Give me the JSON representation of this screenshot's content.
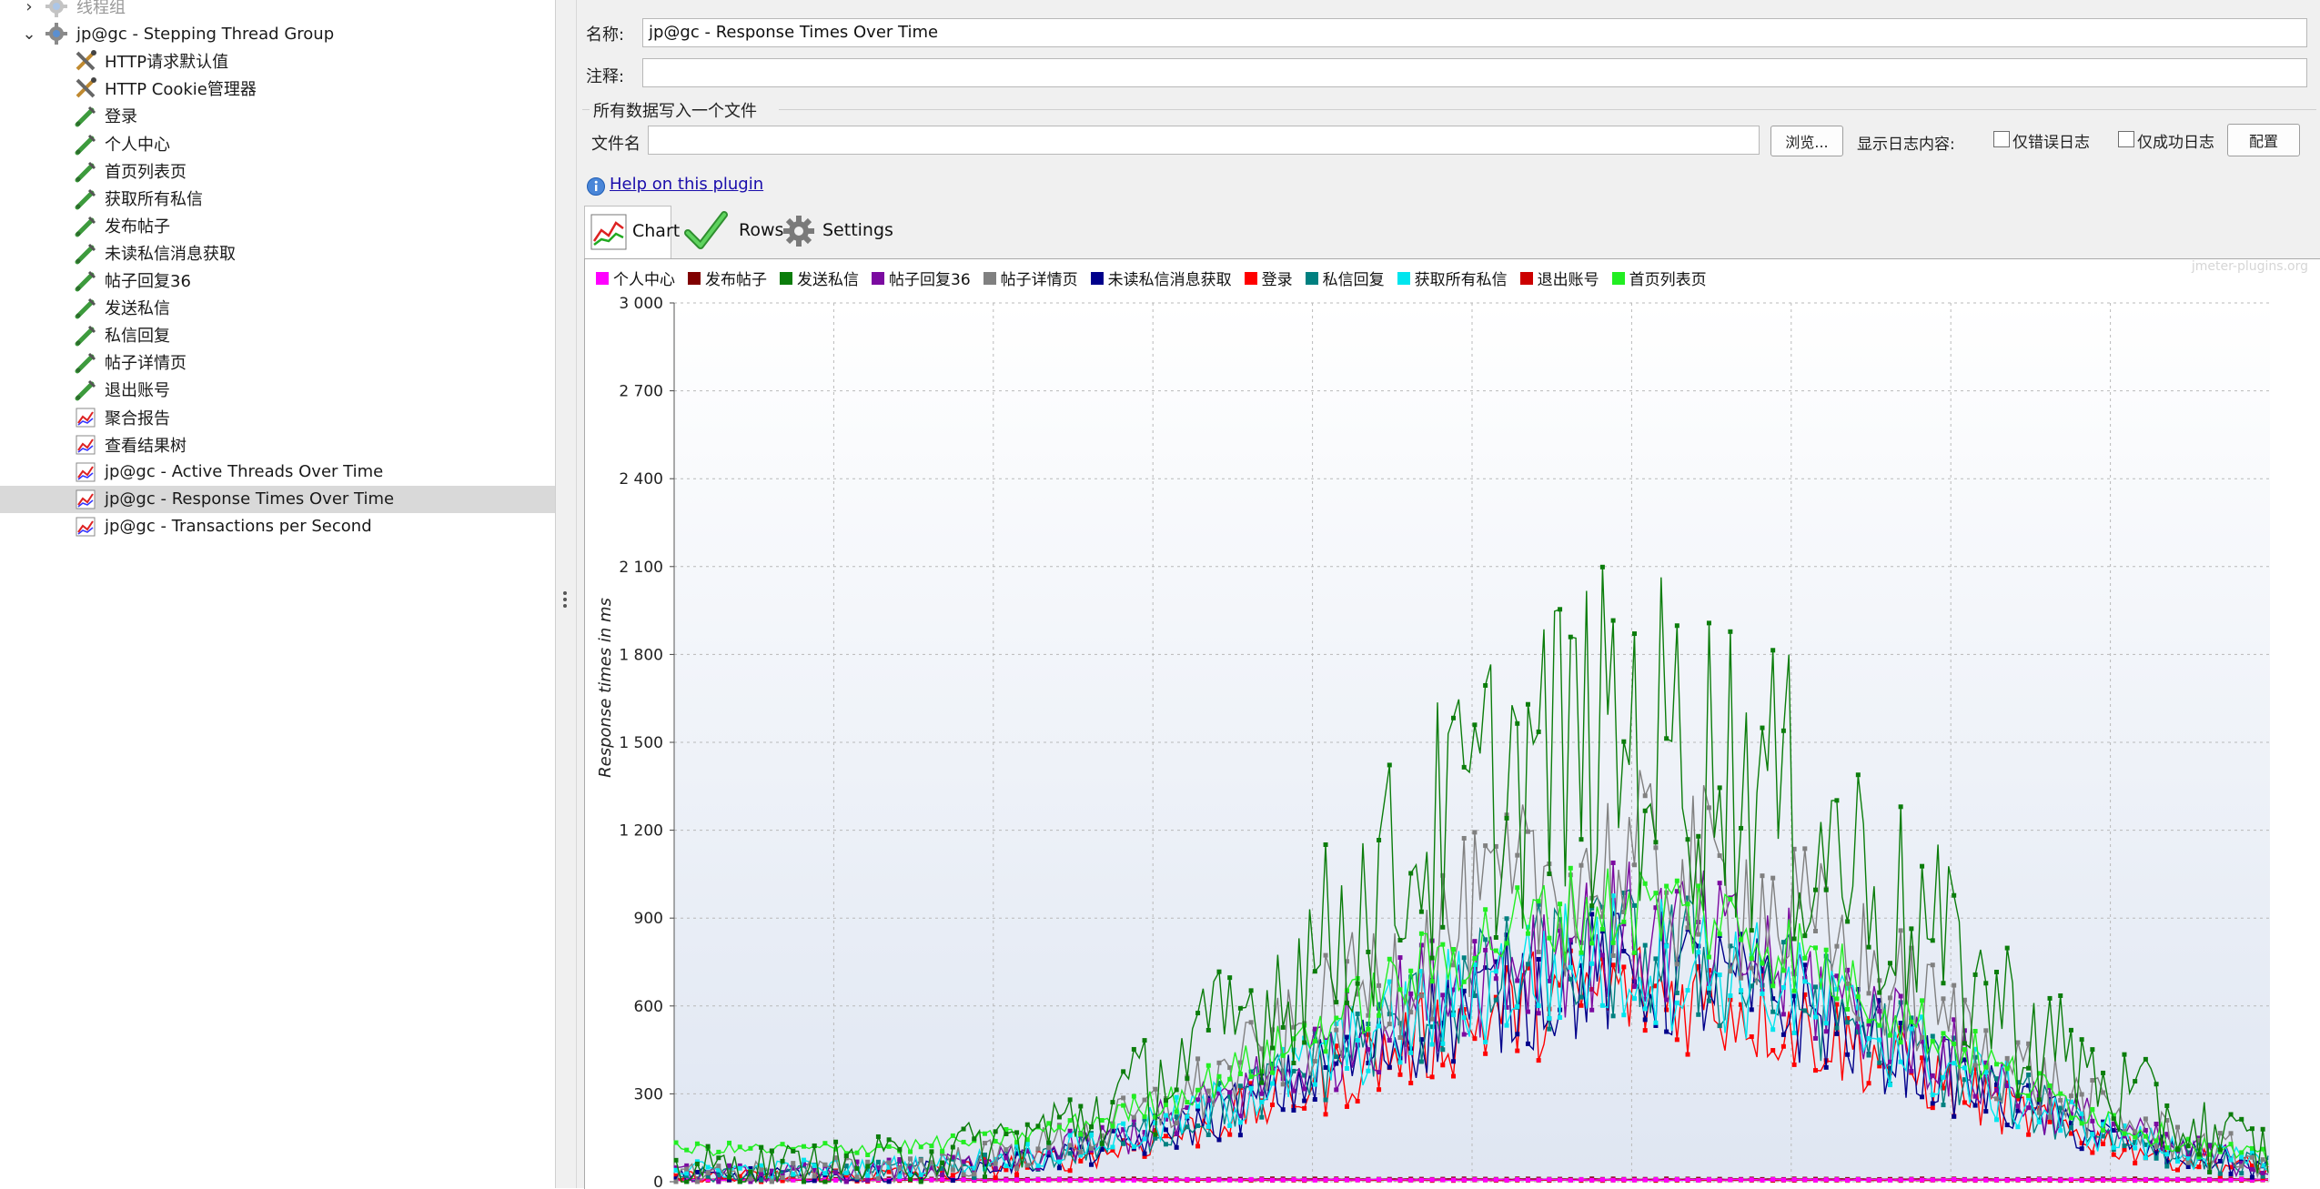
{
  "tree": {
    "items": [
      {
        "label": "线程组",
        "icon": "gear-icon",
        "indent": 0,
        "toggle": "›",
        "faded": true
      },
      {
        "label": "jp@gc - Stepping Thread Group",
        "icon": "gear-icon",
        "indent": 0,
        "toggle": "⌄",
        "faded": false
      },
      {
        "label": "HTTP请求默认值",
        "icon": "wrench-icon",
        "indent": 1
      },
      {
        "label": "HTTP Cookie管理器",
        "icon": "wrench-icon",
        "indent": 1
      },
      {
        "label": "登录",
        "icon": "sampler-icon",
        "indent": 1
      },
      {
        "label": "个人中心",
        "icon": "sampler-icon",
        "indent": 1
      },
      {
        "label": "首页列表页",
        "icon": "sampler-icon",
        "indent": 1
      },
      {
        "label": "获取所有私信",
        "icon": "sampler-icon",
        "indent": 1
      },
      {
        "label": "发布帖子",
        "icon": "sampler-icon",
        "indent": 1
      },
      {
        "label": "未读私信消息获取",
        "icon": "sampler-icon",
        "indent": 1
      },
      {
        "label": "帖子回复36",
        "icon": "sampler-icon",
        "indent": 1
      },
      {
        "label": "发送私信",
        "icon": "sampler-icon",
        "indent": 1
      },
      {
        "label": "私信回复",
        "icon": "sampler-icon",
        "indent": 1
      },
      {
        "label": "帖子详情页",
        "icon": "sampler-icon",
        "indent": 1
      },
      {
        "label": "退出账号",
        "icon": "sampler-icon",
        "indent": 1
      },
      {
        "label": "聚合报告",
        "icon": "listener-icon",
        "indent": 1
      },
      {
        "label": "查看结果树",
        "icon": "listener-icon",
        "indent": 1
      },
      {
        "label": "jp@gc - Active Threads Over Time",
        "icon": "listener-icon",
        "indent": 1
      },
      {
        "label": "jp@gc - Response Times Over Time",
        "icon": "listener-icon",
        "indent": 1,
        "selected": true
      },
      {
        "label": "jp@gc - Transactions per Second",
        "icon": "listener-icon",
        "indent": 1
      }
    ]
  },
  "form": {
    "name_label": "名称:",
    "name_value": "jp@gc - Response Times Over Time",
    "comment_label": "注释:",
    "comment_value": "",
    "file_group_title": "所有数据写入一个文件",
    "filename_label": "文件名",
    "filename_value": "",
    "browse_label": "浏览...",
    "log_display_label": "显示日志内容:",
    "errors_only_label": "仅错误日志",
    "success_only_label": "仅成功日志",
    "configure_label": "配置"
  },
  "help": {
    "link_text": "Help on this plugin"
  },
  "tabs": [
    {
      "label": "Chart",
      "icon": "chart-icon",
      "active": true
    },
    {
      "label": "Rows",
      "icon": "checkmark-icon",
      "active": false
    },
    {
      "label": "Settings",
      "icon": "gear-icon",
      "active": false
    }
  ],
  "chart_data": {
    "type": "line",
    "watermark": "jmeter-plugins.org",
    "ylabel": "Response times in ms",
    "xlabel": "",
    "ylim": [
      0,
      3000
    ],
    "yticks": [
      "0",
      "300",
      "600",
      "900",
      "1 200",
      "1 500",
      "1 800",
      "2 100",
      "2 400",
      "2 700",
      "3 000"
    ],
    "grid": true,
    "legend_position": "top",
    "series": [
      {
        "name": "个人中心",
        "color": "#ff00ff",
        "peak": 0,
        "base": 5,
        "noise": 3
      },
      {
        "name": "发布帖子",
        "color": "#800000",
        "peak": 0,
        "base": 8,
        "noise": 2
      },
      {
        "name": "发送私信",
        "color": "#0b7d0b",
        "peak": 1500,
        "base": 40,
        "noise": 520
      },
      {
        "name": "帖子回复36",
        "color": "#7b0aa0",
        "peak": 830,
        "base": 20,
        "noise": 230
      },
      {
        "name": "帖子详情页",
        "color": "#808080",
        "peak": 1050,
        "base": 25,
        "noise": 300
      },
      {
        "name": "未读私信消息获取",
        "color": "#00008b",
        "peak": 700,
        "base": 15,
        "noise": 200
      },
      {
        "name": "登录",
        "color": "#ff0000",
        "peak": 640,
        "base": 12,
        "noise": 180
      },
      {
        "name": "私信回复",
        "color": "#008080",
        "peak": 760,
        "base": 18,
        "noise": 210
      },
      {
        "name": "获取所有私信",
        "color": "#00e5ee",
        "peak": 740,
        "base": 40,
        "noise": 210
      },
      {
        "name": "退出账号",
        "color": "#cc0000",
        "peak": 0,
        "base": 4,
        "noise": 2
      },
      {
        "name": "首页列表页",
        "color": "#22ee22",
        "peak": 880,
        "base": 110,
        "noise": 150
      }
    ]
  }
}
